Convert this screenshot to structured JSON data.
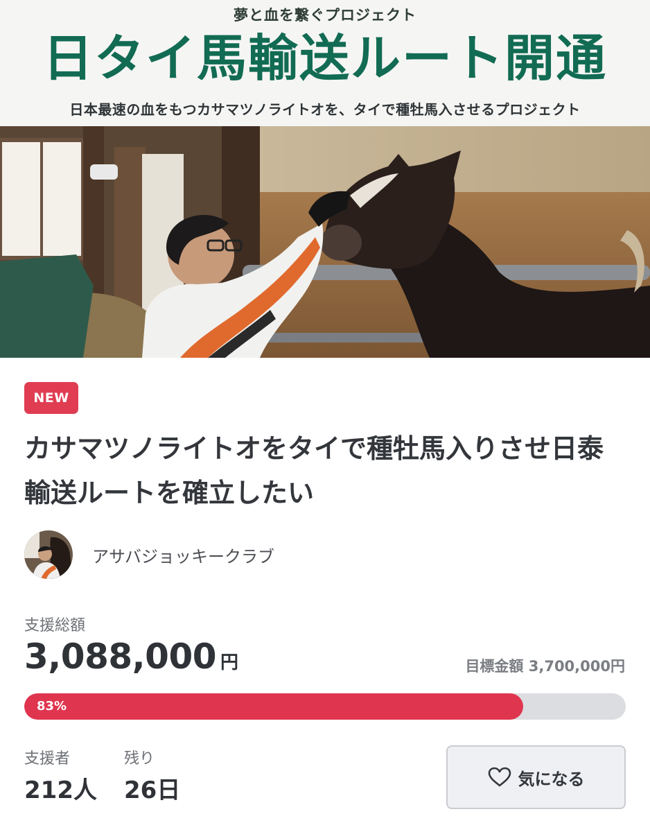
{
  "banner": {
    "top_line": "夢と血を繋ぐプロジェクト",
    "title": "日タイ馬輸送ルート開通",
    "subtitle": "日本最速の血をもつカサマツノライトオを、タイで種牡馬入させるプロジェクト"
  },
  "badge": "NEW",
  "project": {
    "title": "カサマツノライトオをタイで種牡馬入りさせ日泰輸送ルートを確立したい",
    "owner_name": "アサバジョッキークラブ"
  },
  "funding": {
    "total_label": "支援総額",
    "total_amount": "3,088,000",
    "currency_unit": "円",
    "goal_text": "目標金額 3,700,000円",
    "progress_percent": 83,
    "progress_text": "83%"
  },
  "stats": {
    "supporters_label": "支援者",
    "supporters_value": "212人",
    "remaining_label": "残り",
    "remaining_value": "26日"
  },
  "favorite_button": {
    "label": "気になる",
    "icon": "heart-outline-icon"
  },
  "colors": {
    "brand_green": "#126b53",
    "accent_red": "#e0354e",
    "badge_red": "#e03d52"
  }
}
